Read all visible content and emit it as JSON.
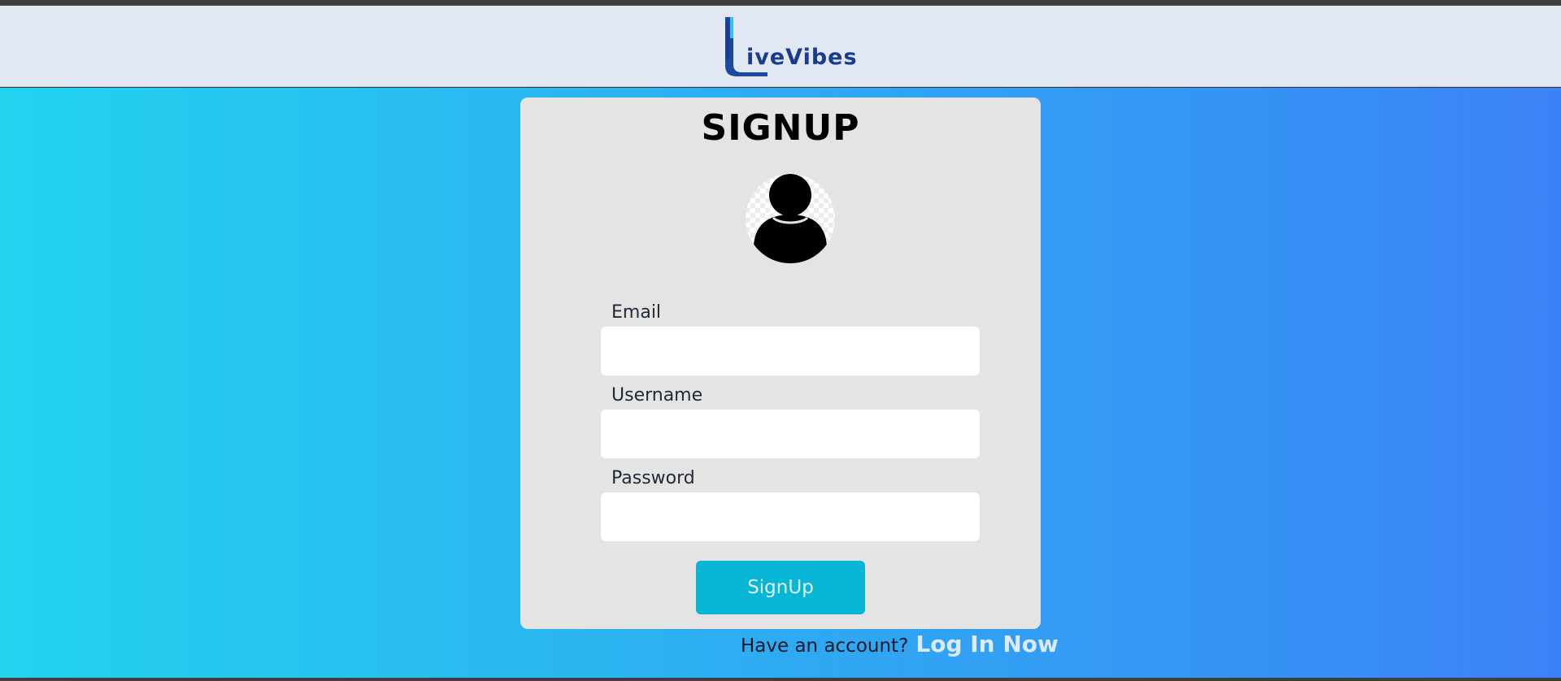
{
  "header": {
    "logo_initial": "L",
    "logo_rest": "iveVibes"
  },
  "form": {
    "title": "SIGNUP",
    "fields": {
      "email": {
        "label": "Email",
        "value": "",
        "placeholder": ""
      },
      "username": {
        "label": "Username",
        "value": "",
        "placeholder": ""
      },
      "password": {
        "label": "Password",
        "value": "",
        "placeholder": ""
      }
    },
    "submit_label": "SignUp"
  },
  "footer": {
    "prompt": "Have an account?",
    "login_link": "Log In Now"
  },
  "icons": {
    "avatar": "user-avatar-icon",
    "logo": "livevibes-logo-icon"
  },
  "colors": {
    "gradient_start": "#22d3ee",
    "gradient_end": "#3b82f6",
    "header_bg": "#e1e8f1",
    "card_bg": "#e4e4e4",
    "button_bg": "#06b6d4",
    "logo_blue": "#1b3c8c"
  }
}
